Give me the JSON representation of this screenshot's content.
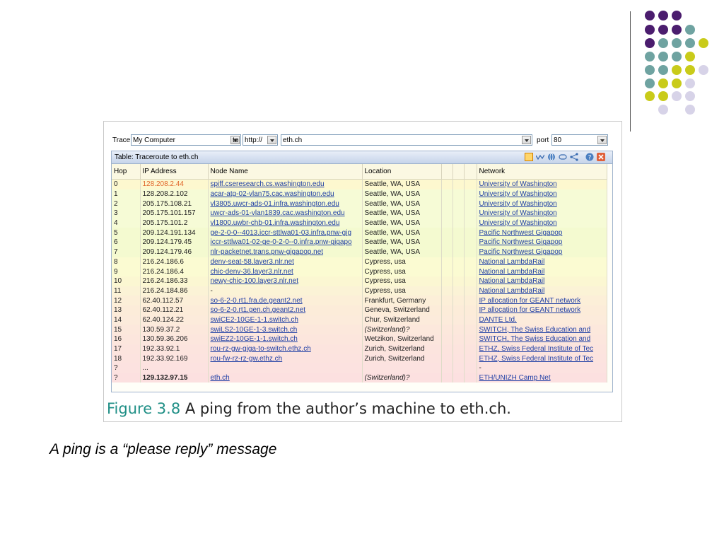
{
  "decor": {
    "dot_colors": {
      "purple": "#4b1d6e",
      "teal": "#6fa3a1",
      "lime": "#c9cb1a",
      "lavender": "#d7d3e8"
    }
  },
  "toolbar": {
    "trace_label": "Trace",
    "source_value": "My Computer",
    "to_label": "to",
    "protocol_value": "http://",
    "host_value": "eth.ch",
    "port_label": "port",
    "port_value": "80"
  },
  "panel": {
    "title": "Table: Traceroute to eth.ch",
    "columns": [
      "Hop",
      "IP Address",
      "Node Name",
      "Location",
      "",
      "",
      "",
      "Network"
    ],
    "rows": [
      {
        "hop": "0",
        "ip": "128.208.2.44",
        "node": "spiff.cseresearch.cs.washington.edu",
        "location": "Seattle, WA, USA",
        "network": "University of Washington",
        "color": "#fdf8cf"
      },
      {
        "hop": "1",
        "ip": "128.208.2.102",
        "node": "acar-atg-02-vlan75.cac.washington.edu",
        "location": "Seattle, WA, USA",
        "network": "University of Washington",
        "color": "#f6fbd6"
      },
      {
        "hop": "2",
        "ip": "205.175.108.21",
        "node": "vl3805.uwcr-ads-01.infra.washington.edu",
        "location": "Seattle, WA, USA",
        "network": "University of Washington",
        "color": "#f6fbd6"
      },
      {
        "hop": "3",
        "ip": "205.175.101.157",
        "node": "uwcr-ads-01-vlan1839.cac.washington.edu",
        "location": "Seattle, WA, USA",
        "network": "University of Washington",
        "color": "#f6fbd6"
      },
      {
        "hop": "4",
        "ip": "205.175.101.2",
        "node": "vl1800.uwbr-chb-01.infra.washington.edu",
        "location": "Seattle, WA, USA",
        "network": "University of Washington",
        "color": "#f6fbd6"
      },
      {
        "hop": "5",
        "ip": "209.124.191.134",
        "node": "ge-2-0-0--4013.iccr-sttlwa01-03.infra.pnw-gig",
        "location": "Seattle, WA, USA",
        "network": "Pacific Northwest Gigapop",
        "color": "#f4fad0"
      },
      {
        "hop": "6",
        "ip": "209.124.179.45",
        "node": "iccr-sttlwa01-02-ge-0-2-0--0.infra.pnw-gigapo",
        "location": "Seattle, WA, USA",
        "network": "Pacific Northwest Gigapop",
        "color": "#f4fad0"
      },
      {
        "hop": "7",
        "ip": "209.124.179.46",
        "node": "nlr-packetnet.trans.pnw-gigapop.net",
        "location": "Seattle, WA, USA",
        "network": "Pacific Northwest Gigapop",
        "color": "#f4fad0"
      },
      {
        "hop": "8",
        "ip": "216.24.186.6",
        "node": "denv-seat-58.layer3.nlr.net",
        "location": "Cypress, usa",
        "network": "National LambdaRail",
        "color": "#fbfbd2"
      },
      {
        "hop": "9",
        "ip": "216.24.186.4",
        "node": "chic-denv-36.layer3.nlr.net",
        "location": "Cypress, usa",
        "network": "National LambdaRail",
        "color": "#fbfbd2"
      },
      {
        "hop": "10",
        "ip": "216.24.186.33",
        "node": "newy-chic-100.layer3.nlr.net",
        "location": "Cypress, usa",
        "network": "National LambdaRail",
        "color": "#fbf7d2"
      },
      {
        "hop": "11",
        "ip": "216.24.184.86",
        "node": "-",
        "location": "Cypress, usa",
        "network": "National LambdaRail",
        "color": "#fbf3d6"
      },
      {
        "hop": "12",
        "ip": "62.40.112.57",
        "node": "so-6-2-0.rt1.fra.de.geant2.net",
        "location": "Frankfurt, Germany",
        "network": "IP allocation for GEANT network",
        "color": "#fcefd8"
      },
      {
        "hop": "13",
        "ip": "62.40.112.21",
        "node": "so-6-2-0.rt1.gen.ch.geant2.net",
        "location": "Geneva, Switzerland",
        "network": "IP allocation for GEANT network",
        "color": "#fcecd9"
      },
      {
        "hop": "14",
        "ip": "62.40.124.22",
        "node": "swiCE2-10GE-1-1.switch.ch",
        "location": "Chur, Switzerland",
        "network": "DANTE Ltd.",
        "color": "#fcebdb"
      },
      {
        "hop": "15",
        "ip": "130.59.37.2",
        "node": "swiLS2-10GE-1-3.switch.ch",
        "location": "(Switzerland)?",
        "network": "SWITCH, The Swiss Education and",
        "color": "#fce8dc"
      },
      {
        "hop": "16",
        "ip": "130.59.36.206",
        "node": "swiEZ2-10GE-1-1.switch.ch",
        "location": "Wetzikon, Switzerland",
        "network": "SWITCH, The Swiss Education and",
        "color": "#fce6dd"
      },
      {
        "hop": "17",
        "ip": "192.33.92.1",
        "node": "rou-rz-gw-giga-to-switch.ethz.ch",
        "location": "Zurich, Switzerland",
        "network": "ETHZ, Swiss Federal Institute of Tec",
        "color": "#fce4de"
      },
      {
        "hop": "18",
        "ip": "192.33.92.169",
        "node": "rou-fw-rz-rz-gw.ethz.ch",
        "location": "Zurich, Switzerland",
        "network": "ETHZ, Swiss Federal Institute of Tec",
        "color": "#fce3df"
      },
      {
        "hop": "?",
        "ip": "...",
        "node": "",
        "location": "",
        "network": "-",
        "color": "#fce2e0"
      },
      {
        "hop": "?",
        "ip": "129.132.97.15",
        "node": "eth.ch",
        "location": "(Switzerland)?",
        "network": "ETH/UNIZH Camp Net",
        "color": "#fce0e0"
      }
    ]
  },
  "caption": {
    "figure_label": "Figure 3.8",
    "text_prefix": "A ping from the author’s machine to ",
    "host": "eth.ch",
    "suffix": "."
  },
  "subtitle": "A ping is a “please reply” message"
}
